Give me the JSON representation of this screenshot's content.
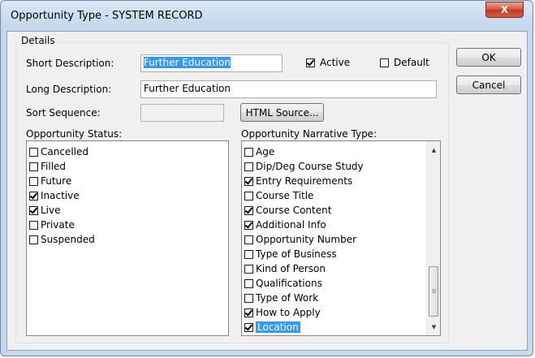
{
  "window": {
    "title": "Opportunity Type - SYSTEM RECORD",
    "close_glyph": "X"
  },
  "details": {
    "group_label": "Details",
    "short_description": {
      "label": "Short Description:",
      "value": "Further Education"
    },
    "long_description": {
      "label": "Long Description:",
      "value": "Further Education"
    },
    "sort_sequence": {
      "label": "Sort Sequence:",
      "value": ""
    },
    "active": {
      "label": "Active",
      "checked": true
    },
    "default": {
      "label": "Default",
      "checked": false
    },
    "html_source_label": "HTML Source..."
  },
  "buttons": {
    "ok": "OK",
    "cancel": "Cancel"
  },
  "opportunity_status": {
    "label": "Opportunity Status:",
    "items": [
      {
        "label": "Cancelled",
        "checked": false
      },
      {
        "label": "Filled",
        "checked": false
      },
      {
        "label": "Future",
        "checked": false
      },
      {
        "label": "Inactive",
        "checked": true
      },
      {
        "label": "Live",
        "checked": true
      },
      {
        "label": "Private",
        "checked": false
      },
      {
        "label": "Suspended",
        "checked": false
      }
    ]
  },
  "narrative_type": {
    "label": "Opportunity Narrative Type:",
    "items": [
      {
        "label": "Age",
        "checked": false
      },
      {
        "label": "Dip/Deg Course Study",
        "checked": false
      },
      {
        "label": "Entry Requirements",
        "checked": true
      },
      {
        "label": "Course Title",
        "checked": false
      },
      {
        "label": "Course Content",
        "checked": true
      },
      {
        "label": "Additional Info",
        "checked": true
      },
      {
        "label": "Opportunity Number",
        "checked": false
      },
      {
        "label": "Type of Business",
        "checked": false
      },
      {
        "label": "Kind of Person",
        "checked": false
      },
      {
        "label": "Qualifications",
        "checked": false
      },
      {
        "label": "Type of Work",
        "checked": false
      },
      {
        "label": "How to Apply",
        "checked": true
      },
      {
        "label": "Location",
        "checked": true,
        "selected": true
      }
    ],
    "scroll_position": 1.0
  }
}
